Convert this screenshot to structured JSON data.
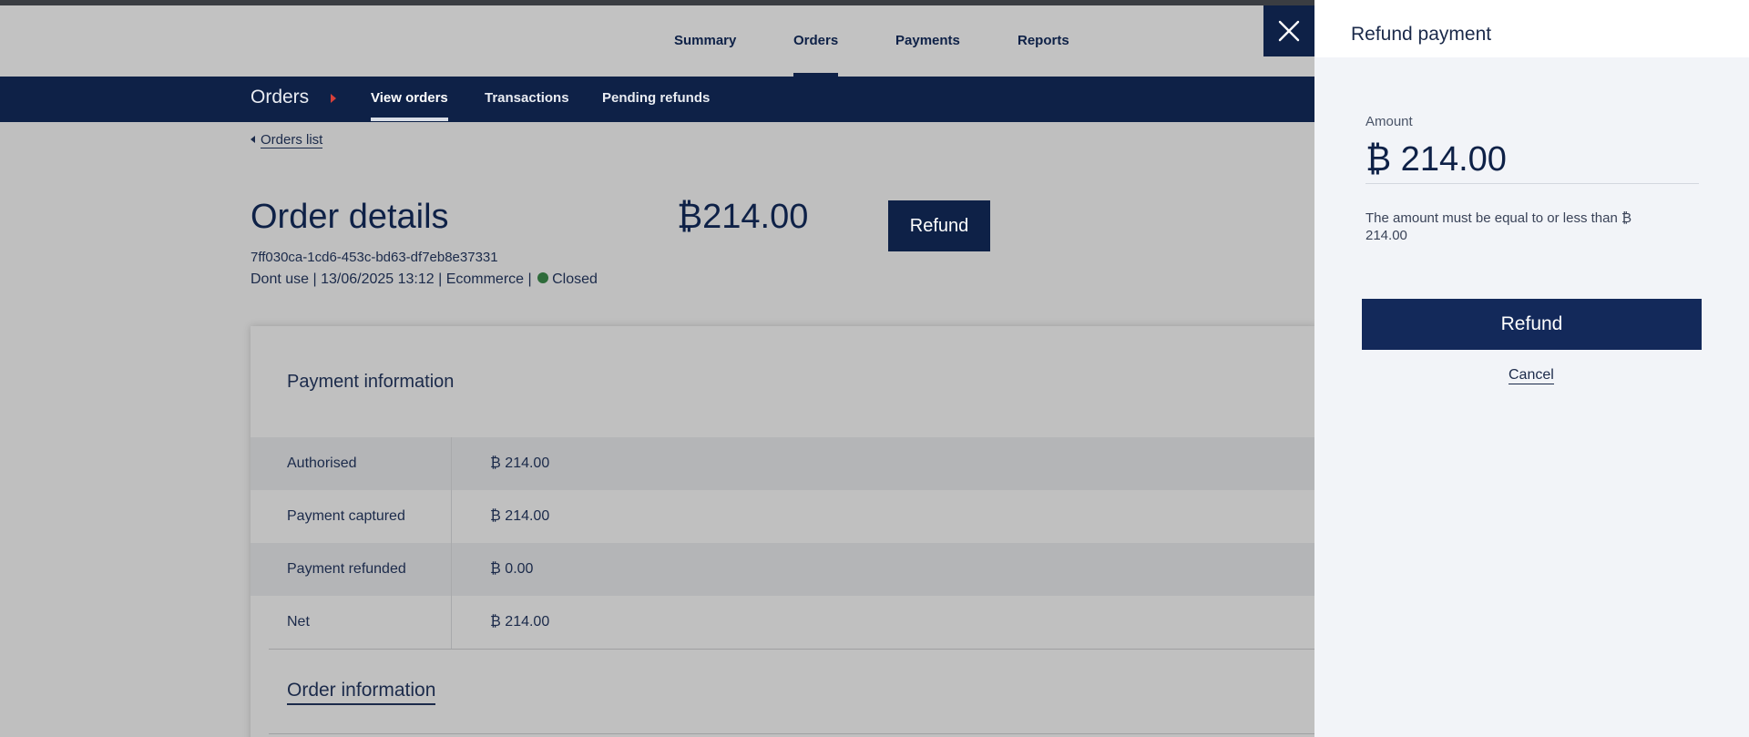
{
  "top_nav": {
    "items": [
      {
        "label": "Summary"
      },
      {
        "label": "Orders",
        "active": true
      },
      {
        "label": "Payments"
      },
      {
        "label": "Reports"
      }
    ]
  },
  "sub_nav": {
    "section": "Orders",
    "tabs": [
      {
        "label": "View orders",
        "active": true
      },
      {
        "label": "Transactions"
      },
      {
        "label": "Pending refunds"
      }
    ]
  },
  "back_link": "Orders list",
  "order": {
    "title": "Order details",
    "amount": "₿214.00",
    "refund_button": "Refund",
    "id": "7ff030ca-1cd6-453c-bd63-df7eb8e37331",
    "meta": "Dont use | 13/06/2025 13:12 | Ecommerce |",
    "status": "Closed",
    "status_color": "#2e6b3a"
  },
  "payment_info": {
    "title": "Payment information",
    "rows": [
      {
        "label": "Authorised",
        "value": "₿ 214.00"
      },
      {
        "label": "Payment captured",
        "value": "₿ 214.00"
      },
      {
        "label": "Payment refunded",
        "value": "₿ 0.00"
      },
      {
        "label": "Net",
        "value": "₿ 214.00"
      }
    ]
  },
  "order_info_link": "Order information",
  "refund_panel": {
    "title": "Refund payment",
    "amount_label": "Amount",
    "amount_value": "₿ 214.00",
    "hint": "The amount must be equal to or less than ₿ 214.00",
    "refund_button": "Refund",
    "cancel_link": "Cancel"
  },
  "colors": {
    "navy": "#0e2147",
    "panel_bg": "#f2f4f8",
    "accent_arrow": "#d6403a"
  }
}
